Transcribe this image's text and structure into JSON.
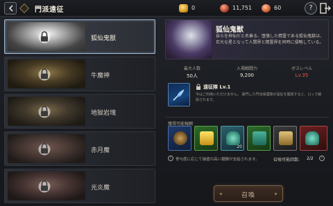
{
  "header": {
    "title": "門派遠征",
    "currencies": [
      {
        "icon": "gold-coin-icon",
        "value": "0"
      },
      {
        "icon": "ruby-icon",
        "value": "11,751"
      },
      {
        "icon": "gem-icon",
        "value": "60"
      }
    ],
    "help_label": "?"
  },
  "beasts": [
    {
      "name": "狐仙鬼獣",
      "selected": true,
      "locked": true
    },
    {
      "name": "牛魔神",
      "selected": false,
      "locked": true
    },
    {
      "name": "地獄岩塊",
      "selected": false,
      "locked": true
    },
    {
      "name": "赤月魔",
      "selected": false,
      "locked": true
    },
    {
      "name": "光炎魔",
      "selected": false,
      "locked": true
    }
  ],
  "detail": {
    "name": "狐仙鬼獣",
    "description": "自らを神仙だと名乗る、堕落した精霊である狐仙鬼獣は、巨大な星となって人間界と精霊界を同時に侵略している。",
    "stats": [
      {
        "label": "最大人数",
        "value": "50人"
      },
      {
        "label": "入場戦闘力",
        "value": "9,200"
      },
      {
        "label": "ボスレベル",
        "value": "Lv.35"
      }
    ],
    "squad": {
      "title": "遠征隊 Lv.1",
      "description": "今はご利用いただけません。\n裏門した門派保護隊が遠征を開放すると、ロック解除されます。"
    },
    "reward_label": "獲得可能報酬",
    "rewards": [
      {
        "icon": "ring-icon",
        "qty": ""
      },
      {
        "icon": "gold-box-icon",
        "qty": ""
      },
      {
        "icon": "jade-statue-icon",
        "qty": "20"
      },
      {
        "icon": "jade-chest-icon",
        "qty": ""
      },
      {
        "icon": "treasure-chest-icon",
        "qty": ""
      },
      {
        "icon": "jade-dragon-icon",
        "qty": ""
      }
    ],
    "note": "寄与度に応じて価値の高い報酬が支給されます。",
    "count_label": "召喚可能回数:",
    "count_value": "2/2",
    "summon_label": "召喚"
  },
  "colors": {
    "selected_border": "#9fb6cf",
    "boss_level": "#e25b4a",
    "summon_text": "#c8b79a"
  }
}
